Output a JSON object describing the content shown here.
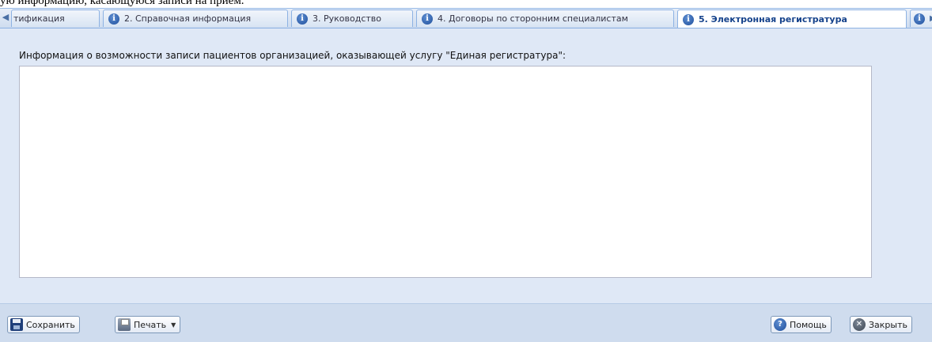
{
  "doc_text": "ую информацию, касающуюся записи на прием.",
  "tabs": {
    "scroll_left_icon": "arrow-left-icon",
    "items": [
      {
        "label": "тификация",
        "has_icon": false
      },
      {
        "label": "2. Справочная информация",
        "has_icon": true
      },
      {
        "label": "3. Руководство",
        "has_icon": true
      },
      {
        "label": "4. Договоры по сторонним специалистам",
        "has_icon": true
      },
      {
        "label": "5. Электронная регистратура",
        "has_icon": true,
        "active": true
      }
    ]
  },
  "form": {
    "field_label": "Информация о возможности записи пациентов организацией, оказывающей услугу \"Единая регистратура\":",
    "field_value": ""
  },
  "footer": {
    "save_label": "Сохранить",
    "print_label": "Печать",
    "help_label": "Помощь",
    "close_label": "Закрыть"
  },
  "colors": {
    "window_bg": "#dfe8f6",
    "tab_border": "#8db2e3",
    "active_tab_text": "#15428b",
    "info_icon": "#1f4f9b"
  }
}
